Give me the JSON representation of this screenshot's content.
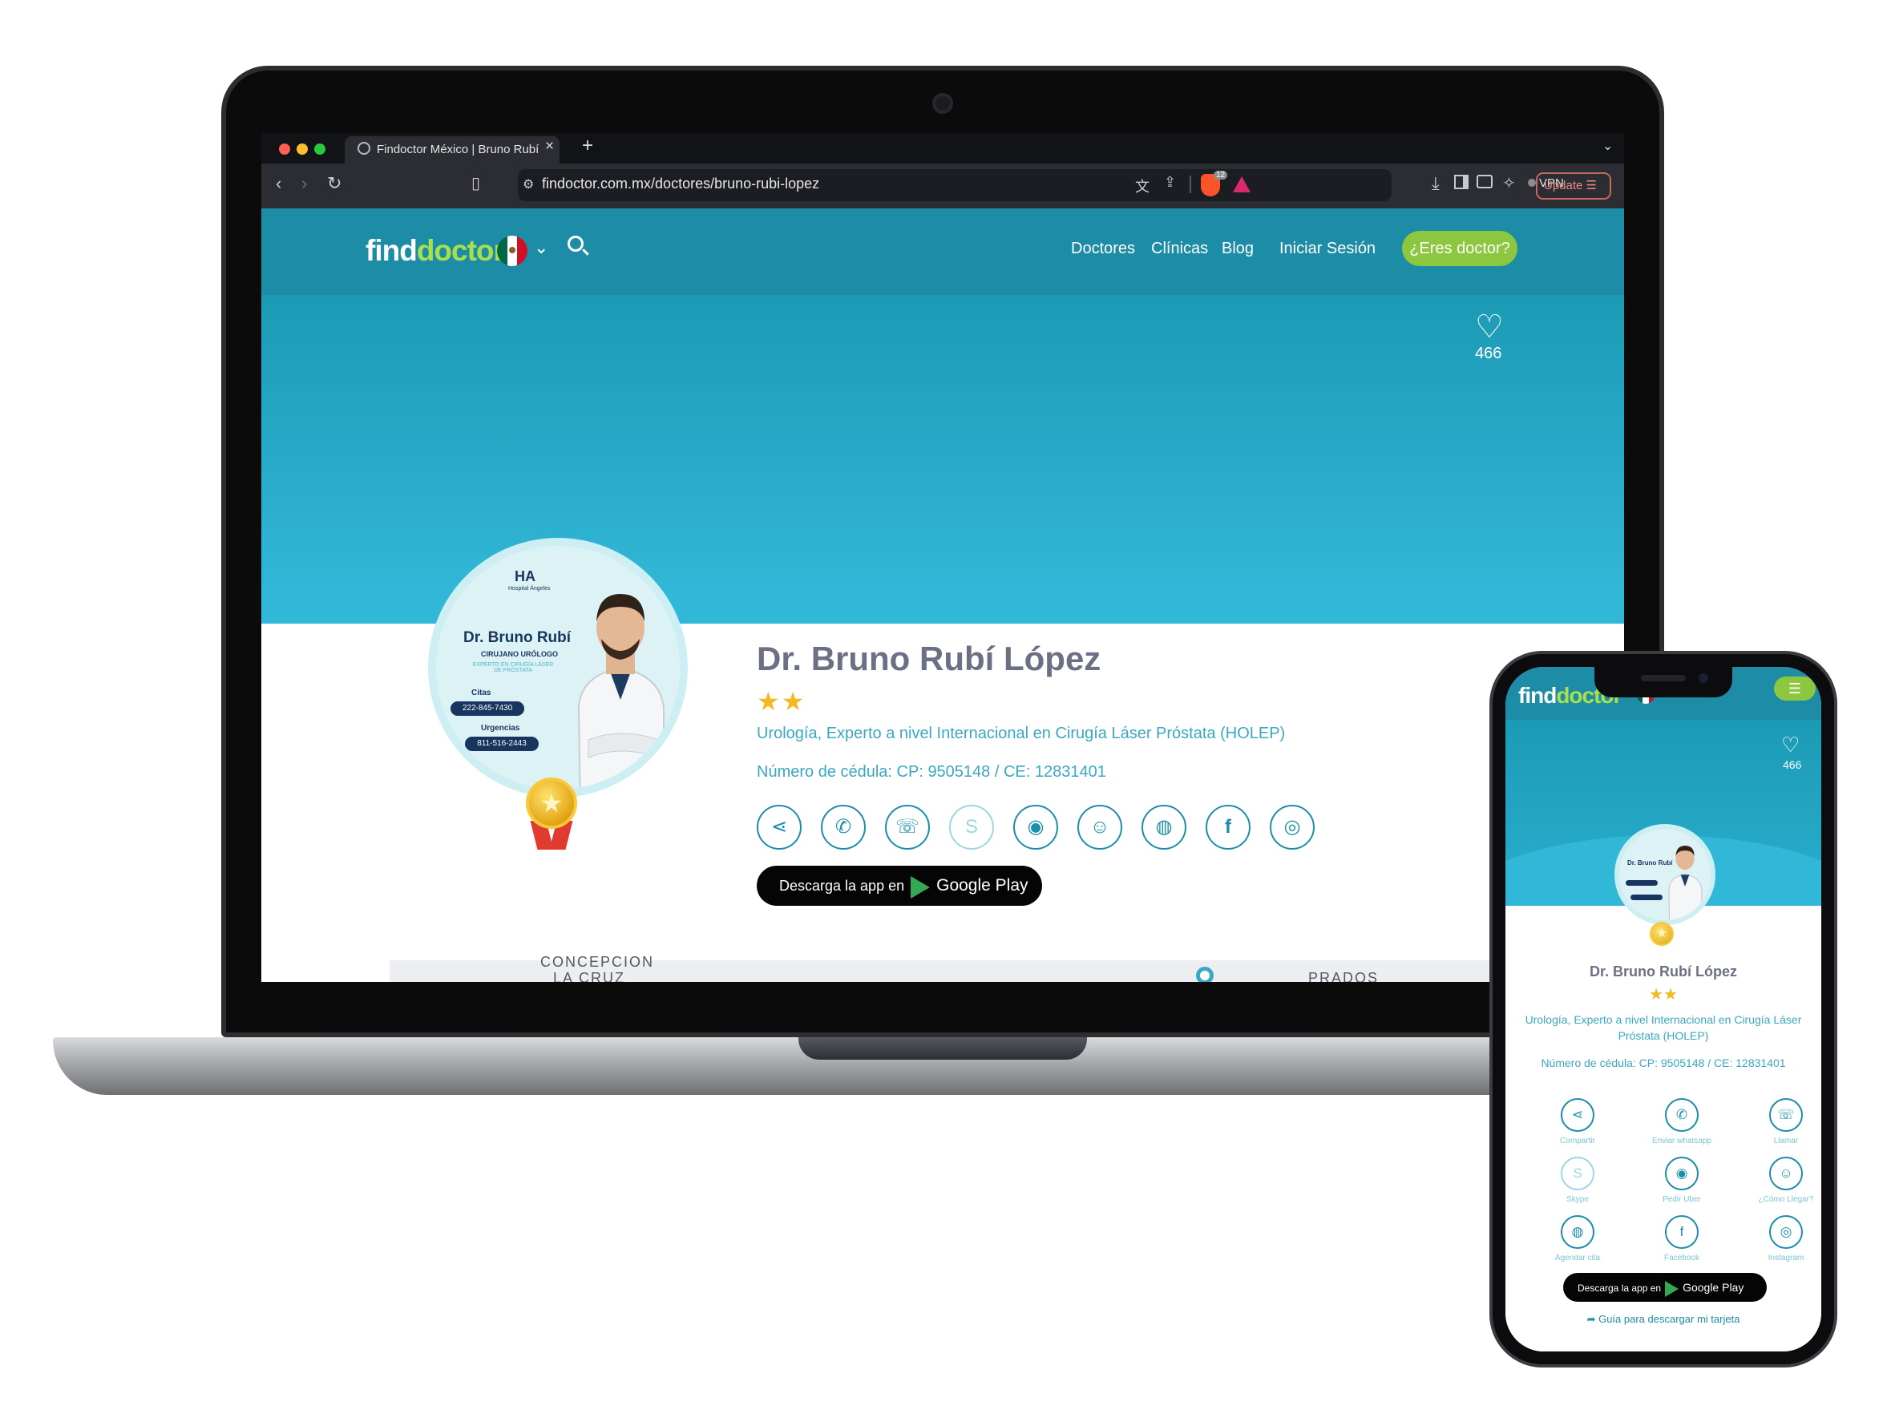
{
  "browser": {
    "tab_title": "Findoctor México | Bruno Rubí",
    "tab_close": "×",
    "new_tab": "+",
    "url": "findoctor.com.mx/doctores/bruno-rubi-lopez",
    "shield_badge": "12",
    "vpn_label": "VPN",
    "update_label": "Update ☰"
  },
  "site": {
    "logo_find": "find",
    "logo_doctor": "octor",
    "logo_d": "d",
    "nav": [
      "Doctores",
      "Clínicas",
      "Blog",
      "Iniciar Sesión"
    ],
    "cta": "¿Eres doctor?",
    "likes": "466"
  },
  "avatar_card": {
    "name": "Dr. Bruno Rubí",
    "role": "CIRUJANO URÓLOGO",
    "tagline": "EXPERTO EN CIRUGÍA LÁSER DE PRÓSTATA",
    "citas_label": "Citas",
    "citas_phone": "222-845-7430",
    "urgencias_label": "Urgencias",
    "urgencias_phone": "811-516-2443",
    "hospital": "Hospital Ángeles"
  },
  "doctor": {
    "name": "Dr. Bruno Rubí López",
    "stars": "★★",
    "specialty": "Urología,   Experto a nivel Internacional en Cirugía Láser Próstata (HOLEP)",
    "cedula": "Número de cédula: CP: 9505148 / CE: 12831401"
  },
  "google_play": {
    "prefix": "Descarga la app en",
    "store": "Google Play"
  },
  "map": {
    "labels": [
      "CONCEPCION",
      "LA CRUZ",
      "PRADOS"
    ]
  },
  "phone": {
    "actions": [
      {
        "label": "Compartir",
        "icon": "share-icon",
        "glyph": "⋖"
      },
      {
        "label": "Enviar whatsapp",
        "icon": "whatsapp-icon",
        "glyph": "✆"
      },
      {
        "label": "Llamar",
        "icon": "phone-icon",
        "glyph": "☏"
      },
      {
        "label": "Skype",
        "icon": "skype-icon",
        "glyph": "S"
      },
      {
        "label": "Pedir Uber",
        "icon": "uber-icon",
        "glyph": "◉"
      },
      {
        "label": "¿Cómo Llegar?",
        "icon": "waze-icon",
        "glyph": "☺"
      },
      {
        "label": "Agendar cita",
        "icon": "globe-icon",
        "glyph": "◍"
      },
      {
        "label": "Facebook",
        "icon": "facebook-icon",
        "glyph": "f"
      },
      {
        "label": "Instagram",
        "icon": "instagram-icon",
        "glyph": "◎"
      }
    ],
    "guide": "Guía para descargar mi tarjeta",
    "menu_glyph": "☰"
  },
  "colors": {
    "brand_teal": "#1d8ca6",
    "hero_cyan": "#31b8d8",
    "lime": "#8dc63f",
    "title_gray": "#6b7084",
    "link_cyan": "#3aa8c2",
    "star_gold": "#f4b820"
  }
}
